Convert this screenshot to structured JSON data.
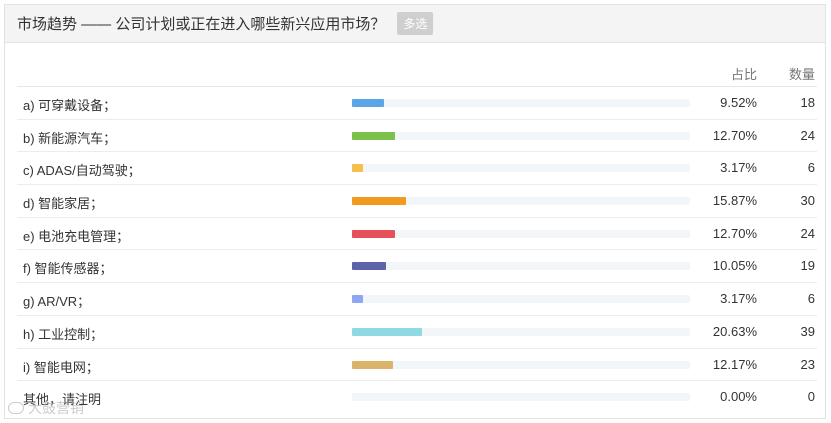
{
  "header": {
    "title": "市场趋势 —— 公司计划或正在进入哪些新兴应用市场？",
    "badge": "多选"
  },
  "columns": {
    "percent": "占比",
    "count": "数量"
  },
  "chart_data": {
    "type": "bar",
    "orientation": "horizontal",
    "categories": [
      "a) 可穿戴设备；",
      "b) 新能源汽车；",
      "c) ADAS/自动驾驶；",
      "d) 智能家居；",
      "e) 电池充电管理；",
      "f) 智能传感器；",
      "g) AR/VR；",
      "h) 工业控制；",
      "i) 智能电网；",
      "其他，请注明"
    ],
    "percent_labels": [
      "9.52%",
      "12.70%",
      "3.17%",
      "15.87%",
      "12.70%",
      "10.05%",
      "3.17%",
      "20.63%",
      "12.17%",
      "0.00%"
    ],
    "percent_values": [
      9.52,
      12.7,
      3.17,
      15.87,
      12.7,
      10.05,
      3.17,
      20.63,
      12.17,
      0.0
    ],
    "counts": [
      18,
      24,
      6,
      30,
      24,
      19,
      6,
      39,
      23,
      0
    ],
    "colors": [
      "#5aa6e6",
      "#7cc24a",
      "#f5c04a",
      "#f29a1e",
      "#e5505a",
      "#5b64a6",
      "#8fa6f0",
      "#8fd9e2",
      "#d9b46a",
      "#cccccc"
    ],
    "xlim": [
      0,
      100
    ]
  },
  "watermark": "大鼓营销"
}
